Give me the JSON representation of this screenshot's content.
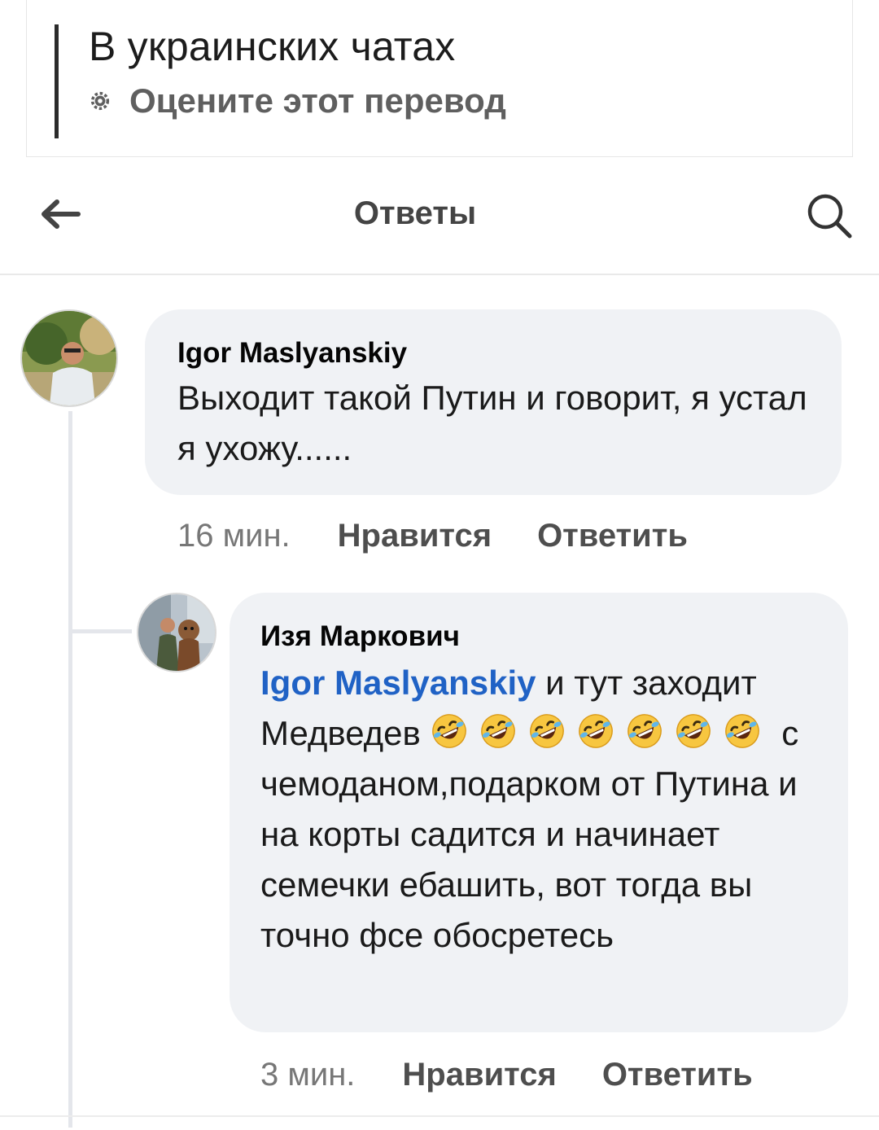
{
  "quote": {
    "text": "В украинских чатах",
    "rate_label": "Оцените этот перевод",
    "rate_icon": "gear-icon"
  },
  "header": {
    "title": "Ответы",
    "back_icon": "arrow-left-icon",
    "search_icon": "search-icon"
  },
  "comments": [
    {
      "author": "Igor Maslyanskiy",
      "text": "Выходит такой Путин и говорит,  я устал я ухожу......",
      "time": "16 мин.",
      "like_label": "Нравится",
      "reply_label": "Ответить"
    },
    {
      "author": "Изя Маркович",
      "mention": "Igor Maslyanskiy",
      "text_part1": " и тут заходит Медведев ",
      "emoji": "rolling-on-the-floor-laughing",
      "emoji_count": 7,
      "text_part2": " с чемоданом,подарком от Путина и на корты садится и начинает семечки ебашить, вот тогда вы точно фсе обосретесь",
      "time": "3 мин.",
      "like_label": "Нравится",
      "reply_label": "Ответить"
    }
  ],
  "colors": {
    "bubble": "#f0f2f5",
    "mention": "#2062c5",
    "thread_line": "#e4e6eb"
  }
}
